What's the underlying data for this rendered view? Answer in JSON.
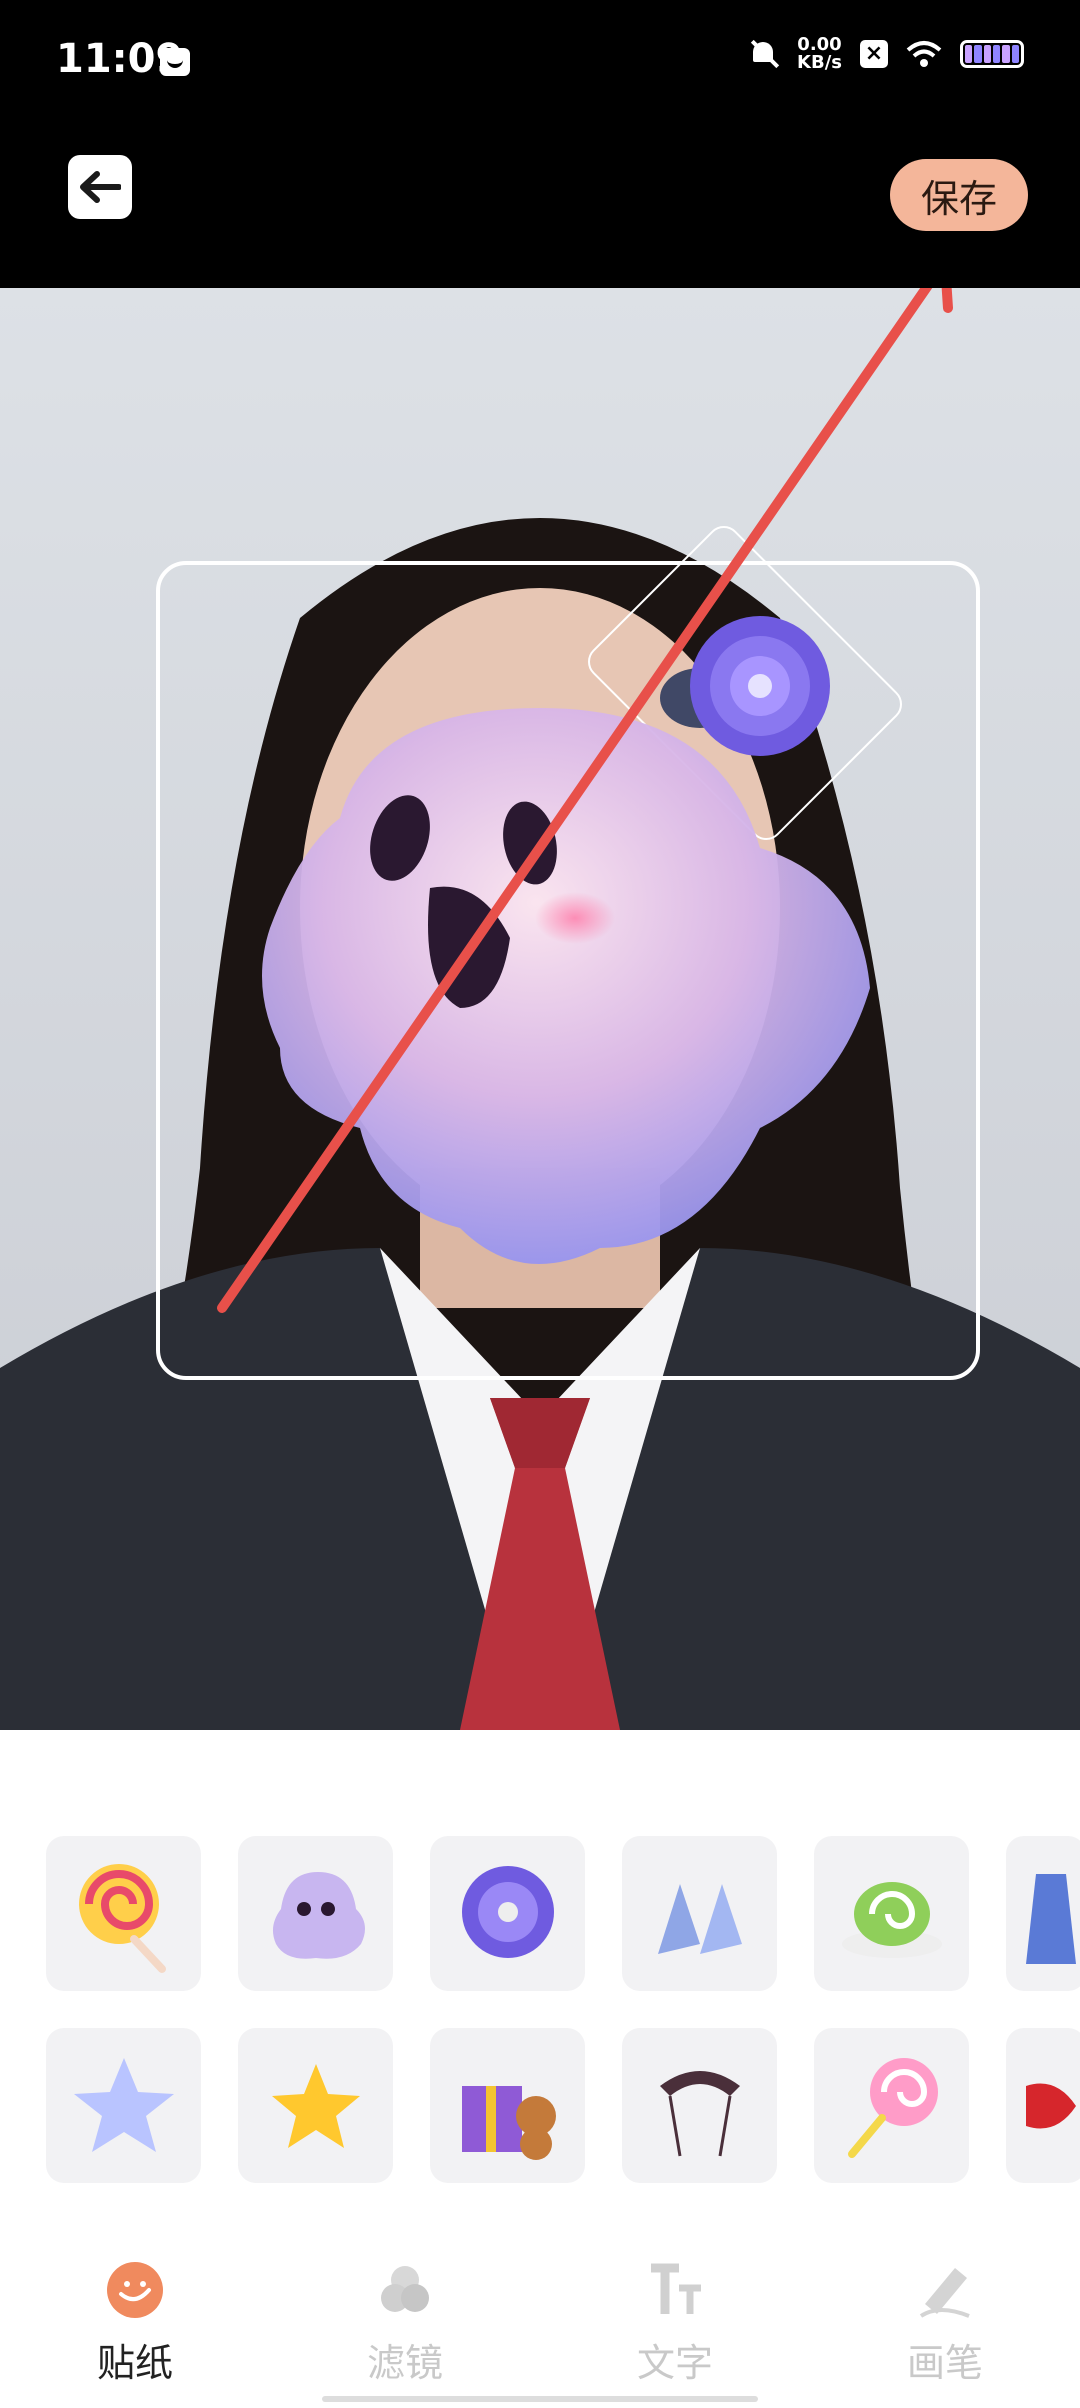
{
  "status_bar": {
    "time": "11:09",
    "net_speed_value": "0.00",
    "net_speed_unit": "KB/s",
    "icons": [
      "message-icon",
      "mute-bell-icon",
      "x-badge-icon",
      "wifi-icon",
      "battery-icon"
    ]
  },
  "header": {
    "back_icon": "arrow-left-icon",
    "save_label": "保存"
  },
  "canvas": {
    "stickers_applied": [
      "ghost",
      "purple-flower-hairclip"
    ],
    "annotation": "red-arrow"
  },
  "stickers": {
    "row1": [
      {
        "name": "lollipop-swirl"
      },
      {
        "name": "ghost"
      },
      {
        "name": "purple-flower"
      },
      {
        "name": "crystal-heels"
      },
      {
        "name": "cake-roll"
      },
      {
        "name": "blue-dress"
      }
    ],
    "row2": [
      {
        "name": "crystal-star"
      },
      {
        "name": "gold-star"
      },
      {
        "name": "gift-box-teddy"
      },
      {
        "name": "lace-headband"
      },
      {
        "name": "pink-lollipop"
      },
      {
        "name": "red-ribbon"
      }
    ]
  },
  "tabs": [
    {
      "label": "贴纸",
      "icon": "sticker-icon",
      "active": true
    },
    {
      "label": "滤镜",
      "icon": "filter-icon",
      "active": false
    },
    {
      "label": "文字",
      "icon": "text-icon",
      "active": false
    },
    {
      "label": "画笔",
      "icon": "brush-icon",
      "active": false
    }
  ],
  "colors": {
    "accent": "#f4b69a",
    "arrow": "#e8504a",
    "tab_active": "#f08a5e"
  }
}
